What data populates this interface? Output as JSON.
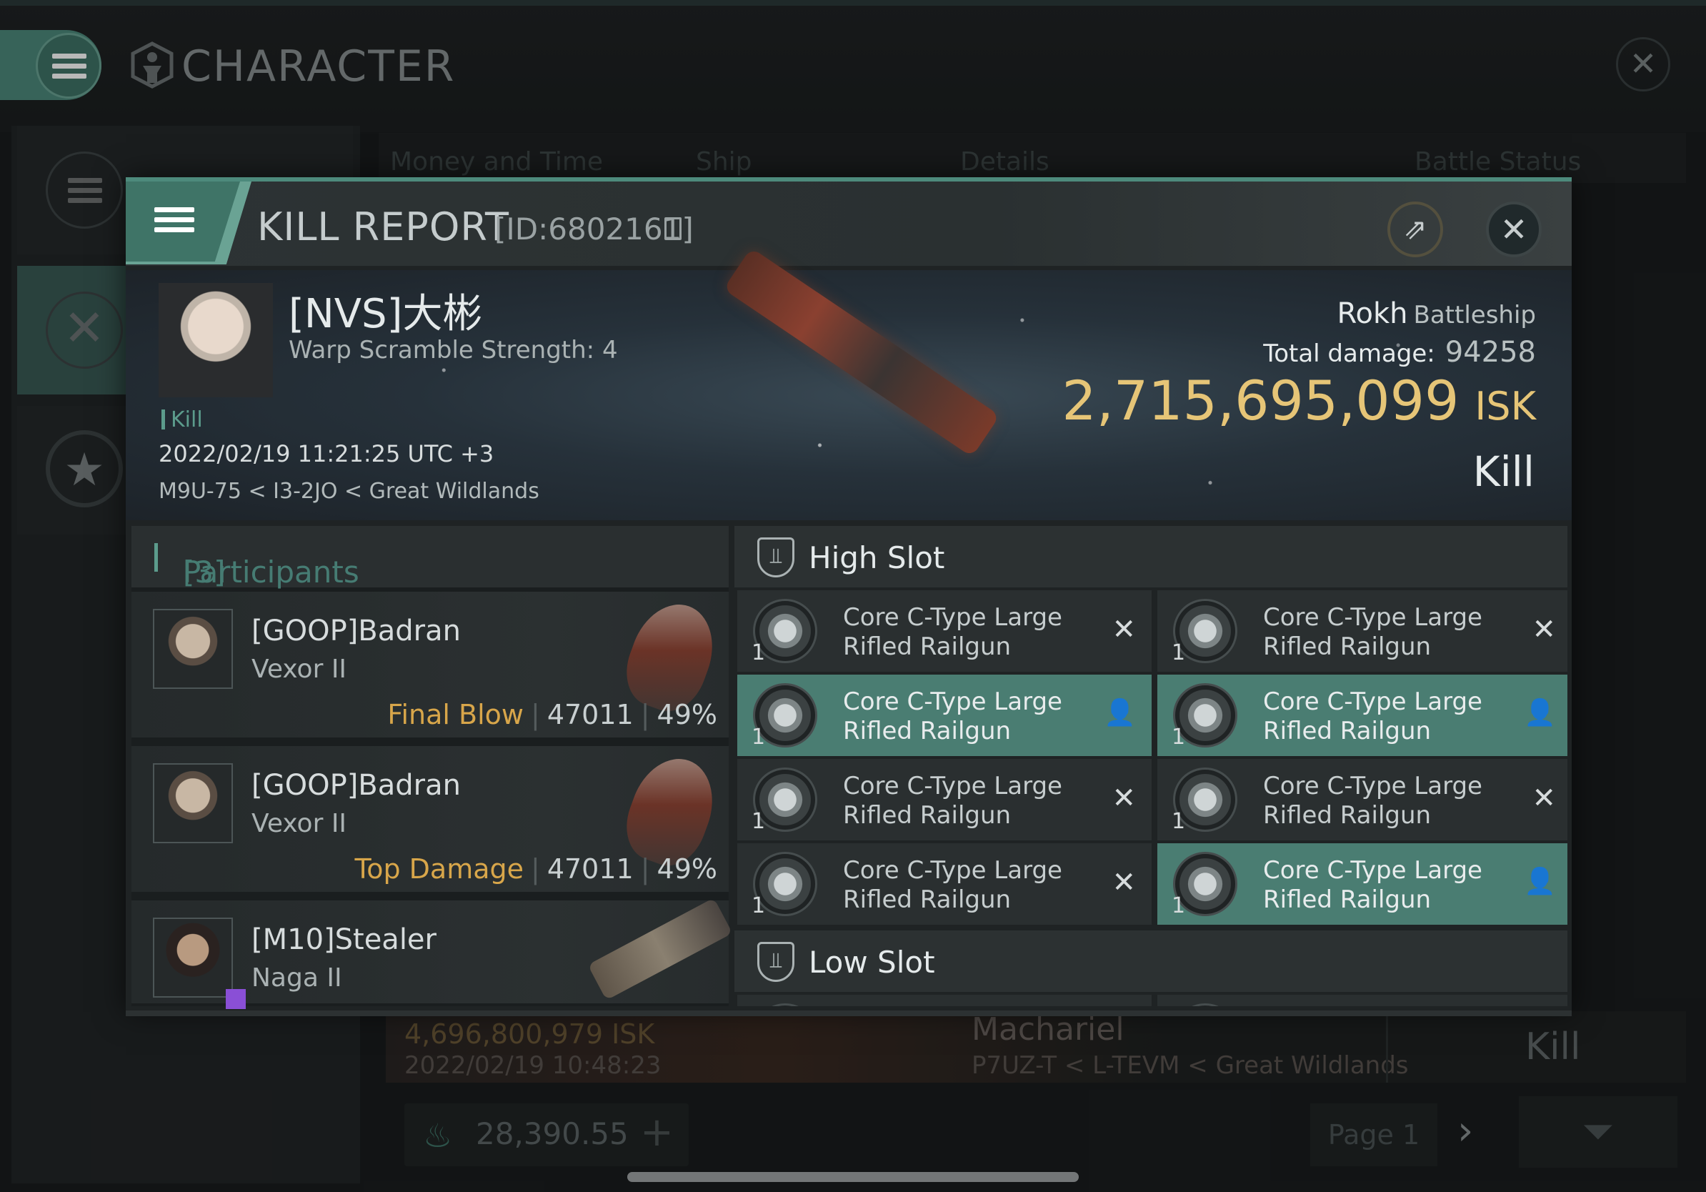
{
  "app": {
    "title": "CHARACTER",
    "tabs": [
      "Money and Time",
      "Ship",
      "Details",
      "Battle Status"
    ]
  },
  "kill_report": {
    "title": "KILL REPORT",
    "id_label": "[ID:6802161]",
    "victim": {
      "name": "[NVS]大彬",
      "warp_scramble": "Warp Scramble Strength: 4",
      "tag": "Kill",
      "datetime": "2022/02/19 11:21:25 UTC +3",
      "location": "M9U-75 < I3-2JO < Great Wildlands",
      "ship_name": "Rokh",
      "ship_class": "Battleship",
      "total_damage_label": "Total damage:",
      "total_damage": "94258",
      "isk_value": "2,715,695,099",
      "isk_unit": "ISK",
      "result": "Kill"
    },
    "participants": {
      "label": "Participants",
      "count": "[3]",
      "list": [
        {
          "name": "[GOOP]Badran",
          "ship": "Vexor II",
          "role": "Final Blow",
          "damage": "47011",
          "percent": "49%"
        },
        {
          "name": "[GOOP]Badran",
          "ship": "Vexor II",
          "role": "Top Damage",
          "damage": "47011",
          "percent": "49%"
        },
        {
          "name": "[M10]Stealer",
          "ship": "Naga II",
          "role": "",
          "damage": "",
          "percent": ""
        }
      ]
    },
    "high_slot": {
      "label": "High Slot",
      "modules": [
        {
          "name": "Core C-Type Large Rifled Railgun",
          "qty": "1",
          "status": "destroyed"
        },
        {
          "name": "Core C-Type Large Rifled Railgun",
          "qty": "1",
          "status": "destroyed"
        },
        {
          "name": "Core C-Type Large Rifled Railgun",
          "qty": "1",
          "status": "dropped"
        },
        {
          "name": "Core C-Type Large Rifled Railgun",
          "qty": "1",
          "status": "dropped"
        },
        {
          "name": "Core C-Type Large Rifled Railgun",
          "qty": "1",
          "status": "destroyed"
        },
        {
          "name": "Core C-Type Large Rifled Railgun",
          "qty": "1",
          "status": "destroyed"
        },
        {
          "name": "Core C-Type Large Rifled Railgun",
          "qty": "1",
          "status": "destroyed"
        },
        {
          "name": "Core C-Type Large Rifled Railgun",
          "qty": "1",
          "status": "dropped"
        }
      ]
    },
    "low_slot": {
      "label": "Low Slot"
    }
  },
  "background_row": {
    "isk": "4,696,800,979  ISK",
    "date": "2022/02/19  10:48:23",
    "ship": "Machariel",
    "location": "P7UZ-T < L-TEVM < Great Wildlands",
    "result": "Kill"
  },
  "footer": {
    "wallet": "28,390.55",
    "page": "Page 1"
  },
  "colors": {
    "accent": "#4d8a7c",
    "isk_gold": "#e6c577",
    "role_orange": "#d8a64a",
    "dropped_row": "#4a7d72"
  }
}
